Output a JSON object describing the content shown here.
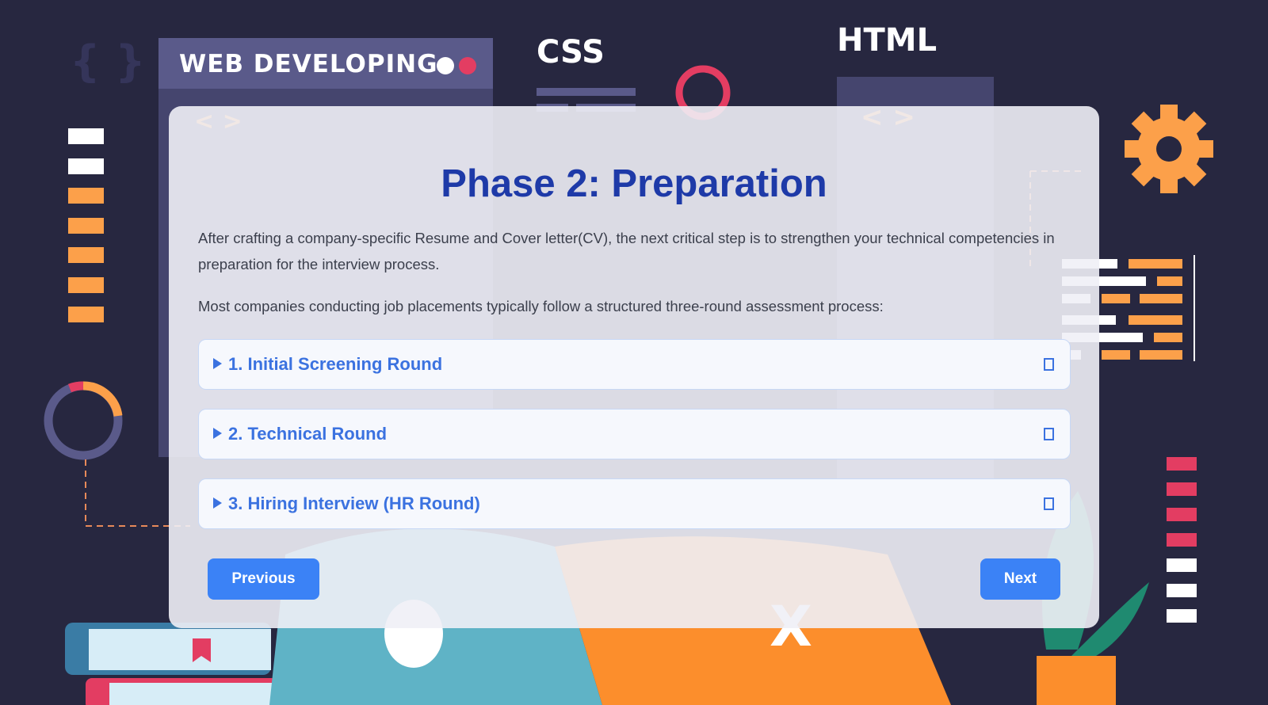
{
  "background": {
    "panel_title": "WEB DEVELOPING",
    "css_label": "CSS",
    "html_label": "HTML",
    "code_bracket_1": "< >",
    "code_bracket_2": "< >",
    "curly_braces": "{ }"
  },
  "card": {
    "title": "Phase 2: Preparation",
    "paragraph_1": "After crafting a company-specific Resume and Cover letter(CV), the next critical step is to strengthen your technical competencies in preparation for the interview process.",
    "paragraph_2": "Most companies conducting job placements typically follow a structured three-round assessment process:",
    "rounds": [
      {
        "label": "1. Initial Screening Round"
      },
      {
        "label": "2. Technical Round"
      },
      {
        "label": "3. Hiring Interview (HR Round)"
      }
    ],
    "previous_label": "Previous",
    "next_label": "Next"
  },
  "colors": {
    "background": "#272740",
    "title": "#1e3aa8",
    "accent": "#3b82f6",
    "accordion_text": "#3b72e0",
    "orange": "#fca04a",
    "pink": "#e33d62"
  },
  "icons": {
    "accordion_arrow": "triangle-right-icon",
    "accordion_toggle": "square-outline-icon",
    "gear": "gear-icon"
  }
}
